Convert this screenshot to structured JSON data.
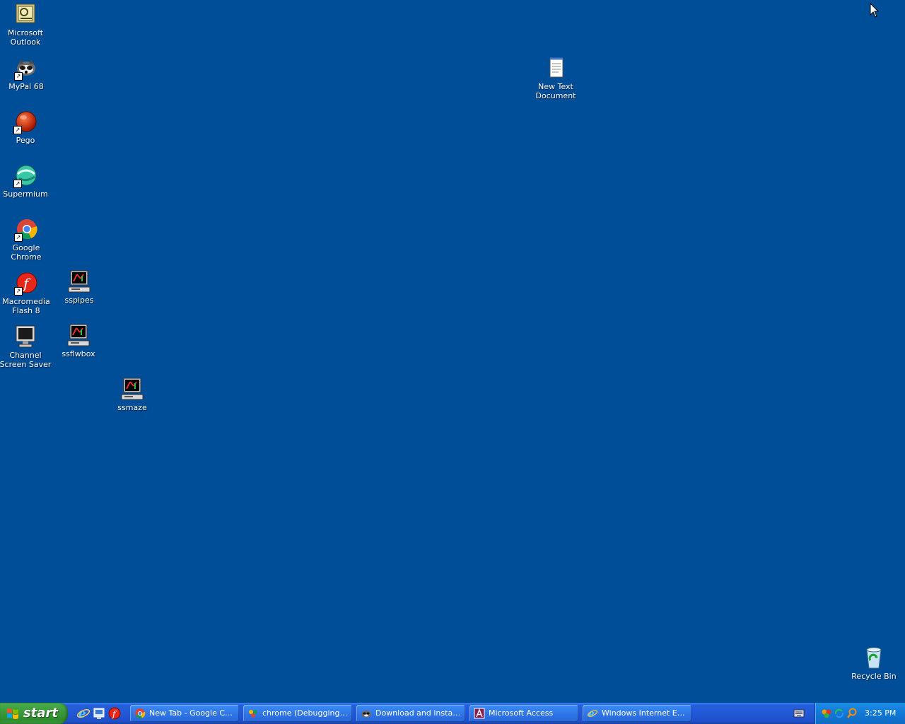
{
  "desktop": {
    "icons": [
      {
        "label": "Microsoft Outlook",
        "icon": "outlook-icon"
      },
      {
        "label": "MyPal 68",
        "icon": "mypal-raccoon-icon"
      },
      {
        "label": "Pego",
        "icon": "pego-icon"
      },
      {
        "label": "Supermium",
        "icon": "supermium-icon"
      },
      {
        "label": "Google Chrome",
        "icon": "chrome-icon"
      },
      {
        "label": "Macromedia Flash 8",
        "icon": "flash-icon"
      },
      {
        "label": "sspipes",
        "icon": "screensaver-icon"
      },
      {
        "label": "Channel Screen Saver",
        "icon": "monitor-icon"
      },
      {
        "label": "ssflwbox",
        "icon": "screensaver-icon"
      },
      {
        "label": "ssmaze",
        "icon": "screensaver-icon"
      },
      {
        "label": "New Text Document",
        "icon": "notepad-icon"
      },
      {
        "label": "Recycle Bin",
        "icon": "recycle-bin-icon"
      }
    ],
    "background_color": "#004E98"
  },
  "taskbar": {
    "start_label": "start",
    "quick_launch": [
      "internet-explorer-icon",
      "show-desktop-icon",
      "flash-icon"
    ],
    "tasks": [
      {
        "label": "New Tab - Google Ch...",
        "icon": "chrome-icon"
      },
      {
        "label": "chrome (Debugging) -...",
        "icon": "debug-icon"
      },
      {
        "label": "Download and installa...",
        "icon": "mypal-raccoon-icon"
      },
      {
        "label": "Microsoft Access",
        "icon": "access-icon"
      },
      {
        "label": "Windows Internet Ex...",
        "icon": "internet-explorer-icon"
      }
    ],
    "tray": {
      "icons": [
        "network-icon",
        "sync-icon",
        "search-icon"
      ],
      "clock": "3:25 PM"
    }
  }
}
